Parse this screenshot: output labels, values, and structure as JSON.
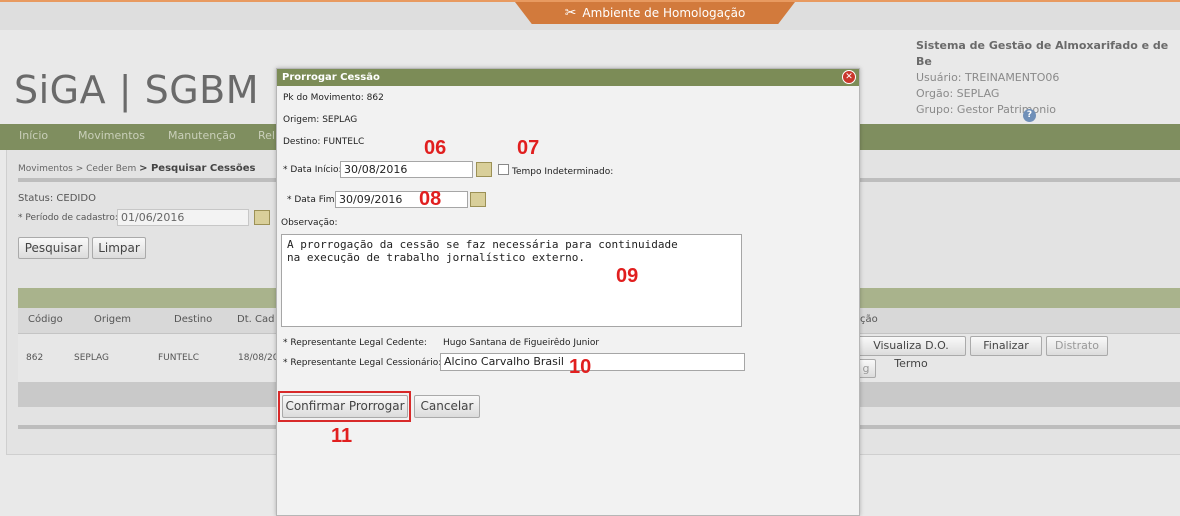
{
  "env": {
    "label": "Ambiente de Homologação",
    "icon": "tools-icon"
  },
  "header": {
    "logo": "SiGA | SGBM",
    "system_title": "Sistema de Gestão de Almoxarifado e de Be",
    "usuario": "Usuário: TREINAMENTO06",
    "orgao": "Orgão: SEPLAG",
    "grupo": "Grupo: Gestor Patrimonio"
  },
  "menu": {
    "items": [
      "Início",
      "Movimentos",
      "Manutenção",
      "Rel"
    ]
  },
  "breadcrumb": {
    "part1": "Movimentos",
    "part2": "> Ceder Bem",
    "part3": "> Pesquisar Cessões"
  },
  "filters": {
    "status": "Status:  CEDIDO",
    "period_label": "* Período de cadastro:",
    "period_value": "01/06/2016",
    "search_button": "Pesquisar",
    "clear_button": "Limpar"
  },
  "grid": {
    "columns": [
      "Código",
      "Origem",
      "Destino",
      "Dt. Cad",
      "ção"
    ],
    "row": {
      "codigo": "862",
      "origem": "SEPLAG",
      "destino": "FUNTELC",
      "dt_cad": "18/08/20"
    },
    "actions": {
      "visualiza": "Visualiza D.O. Termo",
      "finalizar": "Finalizar",
      "distrato": "Distrato",
      "extra": "g"
    }
  },
  "modal": {
    "title": "Prorrogar Cessão",
    "pk": "Pk do Movimento: 862",
    "origem": "Origem: SEPLAG",
    "destino": "Destino: FUNTELC",
    "data_inicio_label": "* Data Início:",
    "data_inicio_value": "30/08/2016",
    "tempo_indeterminado_label": "Tempo Indeterminado:",
    "data_fim_label": "* Data Fim:",
    "data_fim_value": "30/09/2016",
    "observacao_label": "Observação:",
    "observacao_value": "A prorrogação da cessão se faz necessária para continuidade\nna execução de trabalho jornalístico externo.",
    "cedente_label": "* Representante Legal Cedente:",
    "cedente_value": "Hugo Santana de Figueirêdo Junior",
    "cessionario_label": "* Representante Legal Cessionário:",
    "cessionario_value": "Alcino Carvalho Brasil",
    "confirm_button": "Confirmar Prorrogar",
    "cancel_button": "Cancelar"
  },
  "annotations": {
    "a06": "06",
    "a07": "07",
    "a08": "08",
    "a09": "09",
    "a10": "10",
    "a11": "11"
  },
  "colors": {
    "menu": "#7f8e5f",
    "modal_title": "#7c8c57",
    "env_tab": "#d27a3c",
    "annotation": "#e11f1f"
  }
}
